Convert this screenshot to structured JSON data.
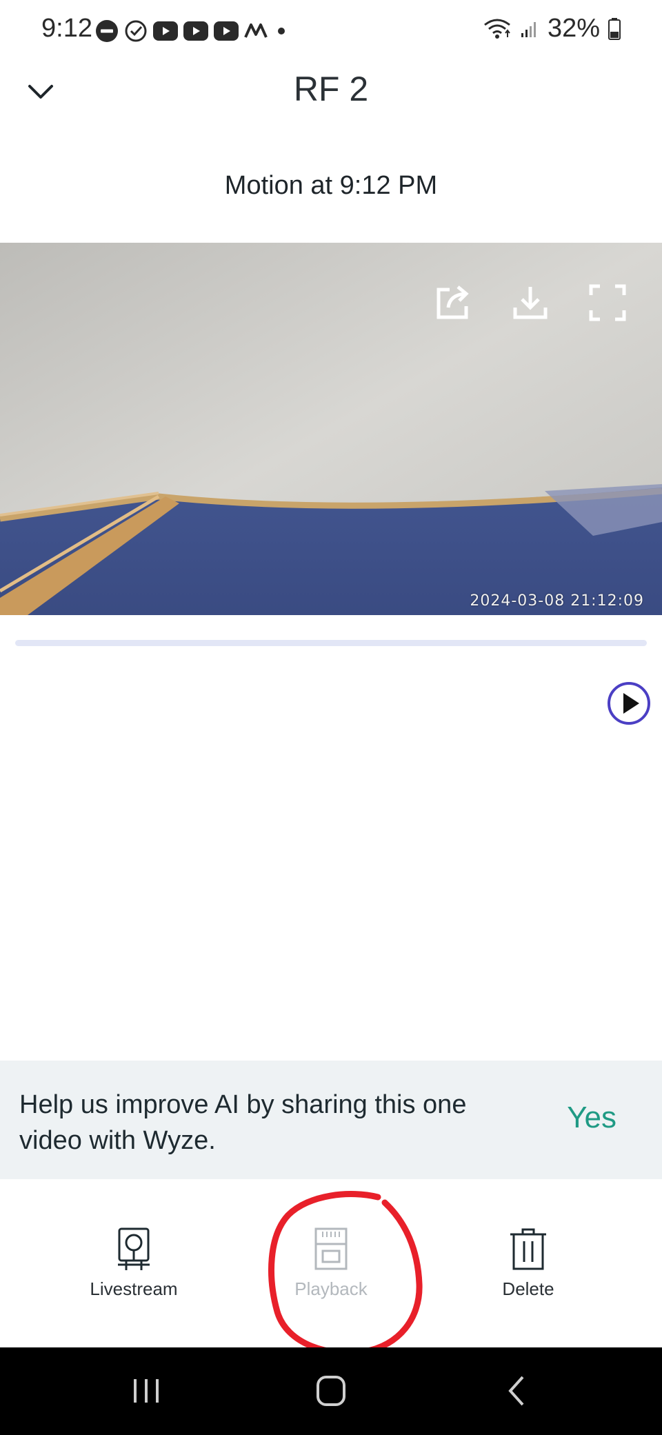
{
  "status_bar": {
    "time": "9:12",
    "battery": "32%",
    "icons": [
      "do-not-disturb-icon",
      "check-circle-icon",
      "youtube-icon",
      "youtube-icon",
      "youtube-icon",
      "m-app-icon",
      "dot-icon",
      "wifi-icon",
      "signal-icon",
      "battery-icon"
    ]
  },
  "header": {
    "title": "RF 2",
    "collapse_icon": "chevron-down-icon"
  },
  "event": {
    "title": "Motion at 9:12 PM"
  },
  "video": {
    "timestamp": "2024-03-08  21:12:09",
    "controls": [
      "share-icon",
      "download-icon",
      "fullscreen-icon"
    ],
    "progress": 0.0
  },
  "ai_banner": {
    "text": "Help us improve AI by sharing this one video with Wyze.",
    "yes_label": "Yes",
    "yes_color": "#1f9a84"
  },
  "actions": [
    {
      "label": "Livestream",
      "icon": "camera-icon",
      "enabled": true
    },
    {
      "label": "Playback",
      "icon": "sd-card-icon",
      "enabled": false
    },
    {
      "label": "Delete",
      "icon": "trash-icon",
      "enabled": true
    }
  ],
  "nav": [
    "recents-icon",
    "home-icon",
    "back-icon"
  ],
  "colors": {
    "accent": "#5145c9",
    "annotation": "#e8202a",
    "banner_bg": "#eef2f4"
  }
}
